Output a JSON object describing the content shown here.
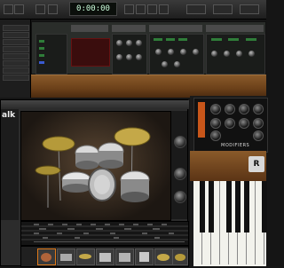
{
  "transport": {
    "time_display": "0:00:00",
    "controls": [
      "rewind",
      "forward",
      "stop",
      "play",
      "record",
      "loop"
    ]
  },
  "modular_synth": {
    "module_titles": [
      "",
      "",
      "",
      "",
      ""
    ]
  },
  "drum_plugin": {
    "logo_text": "alk",
    "controls": [
      "",
      "",
      ""
    ],
    "kit_pieces": [
      "crash-cymbal",
      "ride-cymbal",
      "hi-hat",
      "tom-1",
      "tom-2",
      "snare",
      "kick",
      "floor-tom"
    ],
    "pattern_rows": 5,
    "thumbnails": 8
  },
  "analog_synth": {
    "section_label": "MODIFIERS",
    "badge_text": "R"
  },
  "colors": {
    "accent": "#e07a1a",
    "moog_orange": "#c8561a",
    "wood": "#7a4c22",
    "led_green": "#2f7d39"
  }
}
